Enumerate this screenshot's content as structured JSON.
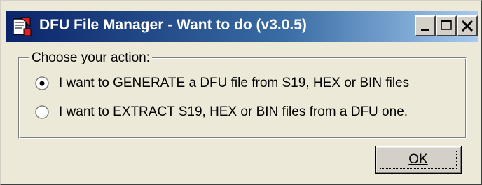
{
  "window": {
    "title": "DFU File Manager - Want to do (v3.0.5)",
    "icon": "dfu-app-icon",
    "controls": {
      "minimize": "minimize-icon",
      "maximize": "maximize-icon",
      "close": "close-icon"
    }
  },
  "group": {
    "legend": "Choose your action:"
  },
  "options": [
    {
      "label": "I want to GENERATE a DFU file from S19, HEX or BIN files",
      "selected": true
    },
    {
      "label": "I want to EXTRACT S19, HEX or BIN files from a DFU one.",
      "selected": false
    }
  ],
  "buttons": {
    "ok_label": "OK"
  },
  "colors": {
    "titlebar_start": "#0a246a",
    "titlebar_end": "#a6caf0",
    "face": "#ece9d8"
  }
}
